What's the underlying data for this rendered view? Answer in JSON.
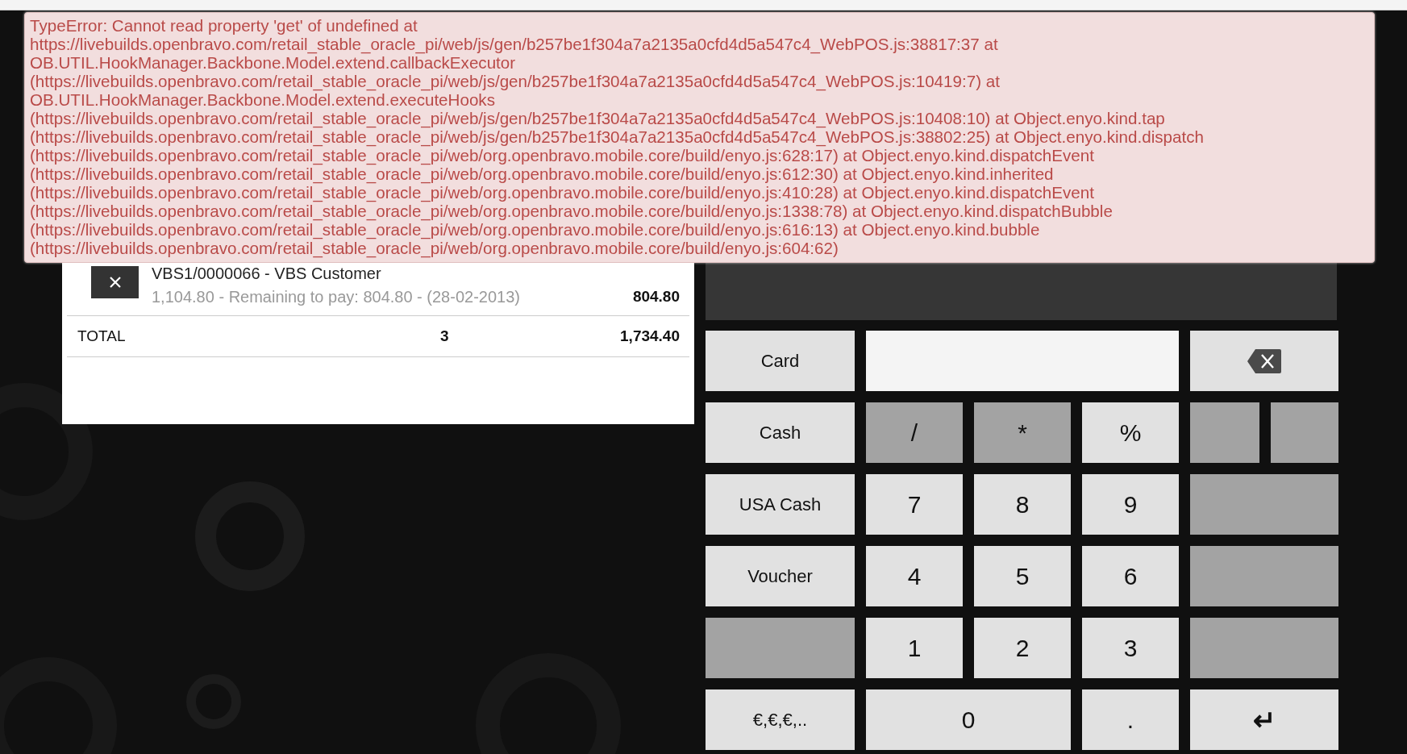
{
  "error": {
    "message": "TypeError: Cannot read property 'get' of undefined at\nhttps://livebuilds.openbravo.com/retail_stable_oracle_pi/web/js/gen/b257be1f304a7a2135a0cfd4d5a547c4_WebPOS.js:38817:37 at\nOB.UTIL.HookManager.Backbone.Model.extend.callbackExecutor\n(https://livebuilds.openbravo.com/retail_stable_oracle_pi/web/js/gen/b257be1f304a7a2135a0cfd4d5a547c4_WebPOS.js:10419:7) at\nOB.UTIL.HookManager.Backbone.Model.extend.executeHooks\n(https://livebuilds.openbravo.com/retail_stable_oracle_pi/web/js/gen/b257be1f304a7a2135a0cfd4d5a547c4_WebPOS.js:10408:10) at Object.enyo.kind.tap\n(https://livebuilds.openbravo.com/retail_stable_oracle_pi/web/js/gen/b257be1f304a7a2135a0cfd4d5a547c4_WebPOS.js:38802:25) at Object.enyo.kind.dispatch\n(https://livebuilds.openbravo.com/retail_stable_oracle_pi/web/org.openbravo.mobile.core/build/enyo.js:628:17) at Object.enyo.kind.dispatchEvent\n(https://livebuilds.openbravo.com/retail_stable_oracle_pi/web/org.openbravo.mobile.core/build/enyo.js:612:30) at Object.enyo.kind.inherited\n(https://livebuilds.openbravo.com/retail_stable_oracle_pi/web/org.openbravo.mobile.core/build/enyo.js:410:28) at Object.enyo.kind.dispatchEvent\n(https://livebuilds.openbravo.com/retail_stable_oracle_pi/web/org.openbravo.mobile.core/build/enyo.js:1338:78) at Object.enyo.kind.dispatchBubble\n(https://livebuilds.openbravo.com/retail_stable_oracle_pi/web/org.openbravo.mobile.core/build/enyo.js:616:13) at Object.enyo.kind.bubble\n(https://livebuilds.openbravo.com/retail_stable_oracle_pi/web/org.openbravo.mobile.core/build/enyo.js:604:62)"
  },
  "orders": [
    {
      "title": "VBS1/0000066 - VBS Customer",
      "detail": "1,104.80 - Remaining to pay: 804.80 - (28-02-2013)",
      "amount": "804.80"
    }
  ],
  "total": {
    "label": "TOTAL",
    "count": "3",
    "amount": "1,734.40"
  },
  "keypad": [
    [
      {
        "kind": "method",
        "label": "Card"
      },
      {
        "kind": "field"
      },
      {
        "kind": "backspace"
      }
    ],
    [
      {
        "kind": "method",
        "label": "Cash"
      },
      {
        "kind": "op",
        "label": "/"
      },
      {
        "kind": "op",
        "label": "*"
      },
      {
        "kind": "digit",
        "label": "%"
      },
      {
        "kind": "blank-half"
      },
      {
        "kind": "blank-half"
      }
    ],
    [
      {
        "kind": "method",
        "label": "USA Cash"
      },
      {
        "kind": "digit",
        "label": "7"
      },
      {
        "kind": "digit",
        "label": "8"
      },
      {
        "kind": "digit",
        "label": "9"
      },
      {
        "kind": "blank"
      }
    ],
    [
      {
        "kind": "method",
        "label": "Voucher"
      },
      {
        "kind": "digit",
        "label": "4"
      },
      {
        "kind": "digit",
        "label": "5"
      },
      {
        "kind": "digit",
        "label": "6"
      },
      {
        "kind": "blank"
      }
    ],
    [
      {
        "kind": "blank-method"
      },
      {
        "kind": "digit",
        "label": "1"
      },
      {
        "kind": "digit",
        "label": "2"
      },
      {
        "kind": "digit",
        "label": "3"
      },
      {
        "kind": "blank"
      }
    ],
    [
      {
        "kind": "method",
        "label": "€,€,€,.."
      },
      {
        "kind": "digit-wide",
        "label": "0"
      },
      {
        "kind": "digit",
        "label": "."
      },
      {
        "kind": "enter",
        "label": "↵"
      }
    ]
  ]
}
